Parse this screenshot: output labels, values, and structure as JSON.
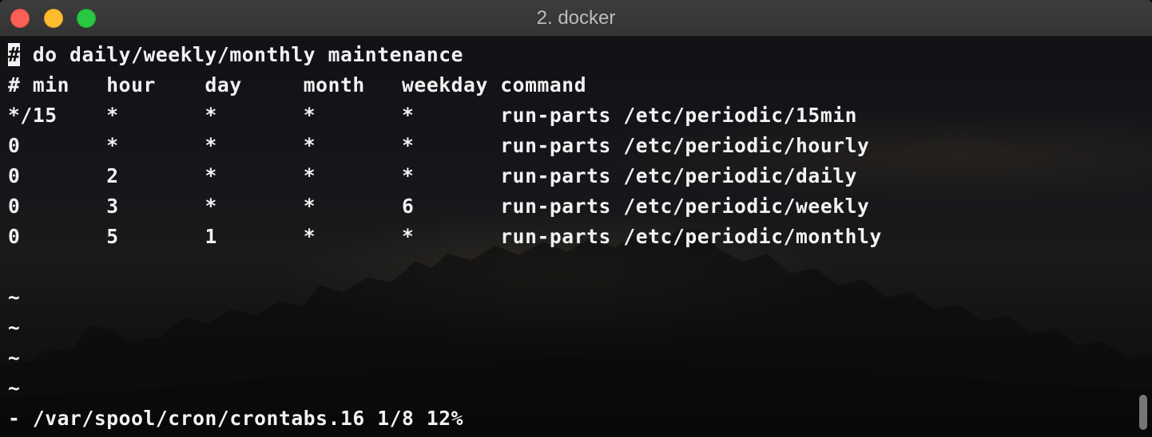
{
  "window": {
    "title": "2. docker"
  },
  "editor": {
    "cursor_char": "#",
    "lines": [
      " do daily/weekly/monthly maintenance",
      "# min   hour    day     month   weekday command",
      "*/15    *       *       *       *       run-parts /etc/periodic/15min",
      "0       *       *       *       *       run-parts /etc/periodic/hourly",
      "0       2       *       *       *       run-parts /etc/periodic/daily",
      "0       3       *       *       6       run-parts /etc/periodic/weekly",
      "0       5       1       *       *       run-parts /etc/periodic/monthly",
      "",
      "~",
      "~",
      "~",
      "~"
    ],
    "status_line": "- /var/spool/cron/crontabs.16 1/8 12%"
  },
  "colors": {
    "close": "#fc5f57",
    "minimize": "#fdbc2e",
    "maximize": "#28c840",
    "text": "#f2f2f2"
  }
}
